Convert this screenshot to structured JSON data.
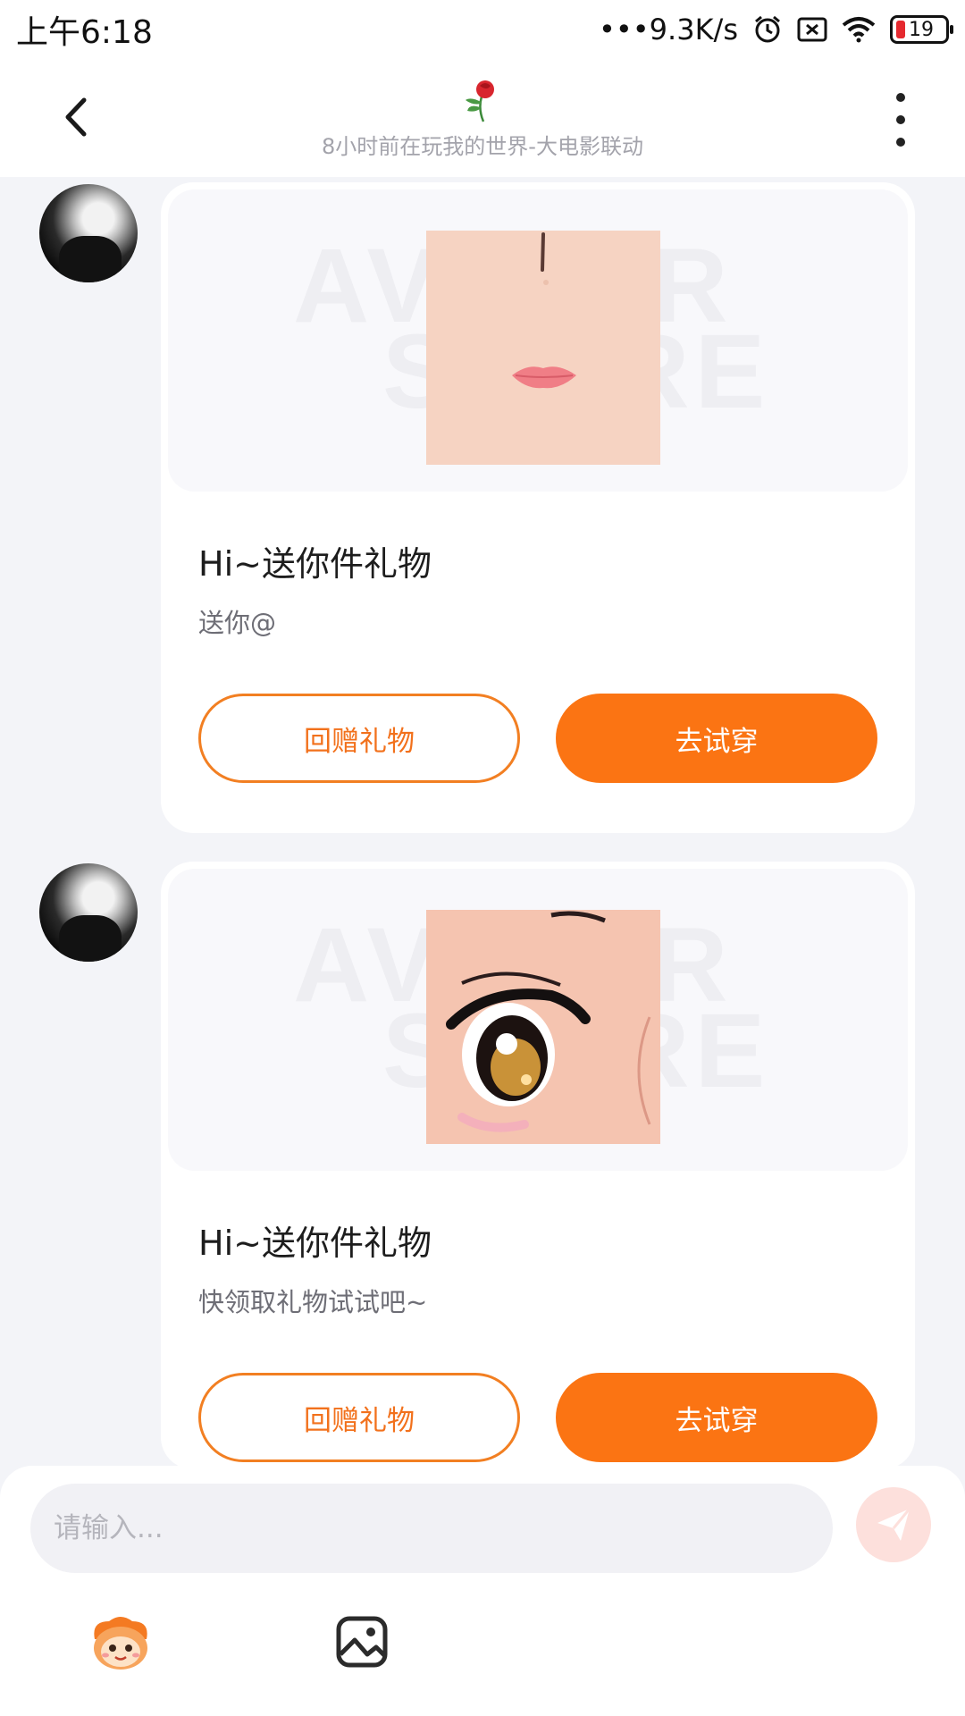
{
  "status_bar": {
    "time": "上午6:18",
    "network_speed": "•••9.3K/s",
    "battery_level": "19"
  },
  "header": {
    "subtitle": "8小时前在玩我的世界-大电影联动"
  },
  "preview_watermark": {
    "line1": "AVATAR",
    "line2": "STORE"
  },
  "messages": [
    {
      "title": "Hi~送你件礼物",
      "description": "送你@",
      "return_gift_label": "回赠礼物",
      "try_on_label": "去试穿"
    },
    {
      "title": "Hi~送你件礼物",
      "description": "快领取礼物试试吧~",
      "return_gift_label": "回赠礼物",
      "try_on_label": "去试穿"
    }
  ],
  "input": {
    "placeholder": "请输入..."
  },
  "colors": {
    "accent": "#fb7413",
    "background": "#f3f4f8"
  }
}
